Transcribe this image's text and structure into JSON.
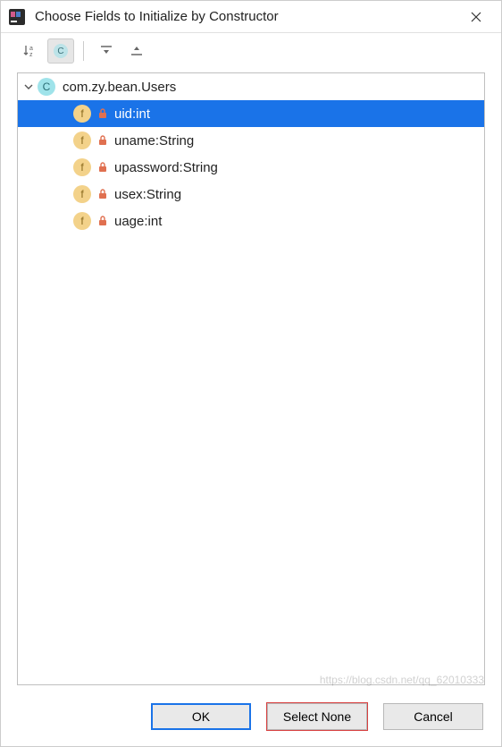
{
  "window": {
    "title": "Choose Fields to Initialize by Constructor"
  },
  "toolbar": {
    "sort_label": "a-z",
    "class_badge": "C"
  },
  "tree": {
    "class_badge_letter": "C",
    "class_fqn": "com.zy.bean.Users",
    "field_badge_letter": "f",
    "fields": [
      {
        "label": "uid:int",
        "selected": true
      },
      {
        "label": "uname:String",
        "selected": false
      },
      {
        "label": "upassword:String",
        "selected": false
      },
      {
        "label": "usex:String",
        "selected": false
      },
      {
        "label": "uage:int",
        "selected": false
      }
    ]
  },
  "buttons": {
    "ok": "OK",
    "select_none": "Select None",
    "cancel": "Cancel"
  },
  "watermark": "https://blog.csdn.net/qq_62010333"
}
